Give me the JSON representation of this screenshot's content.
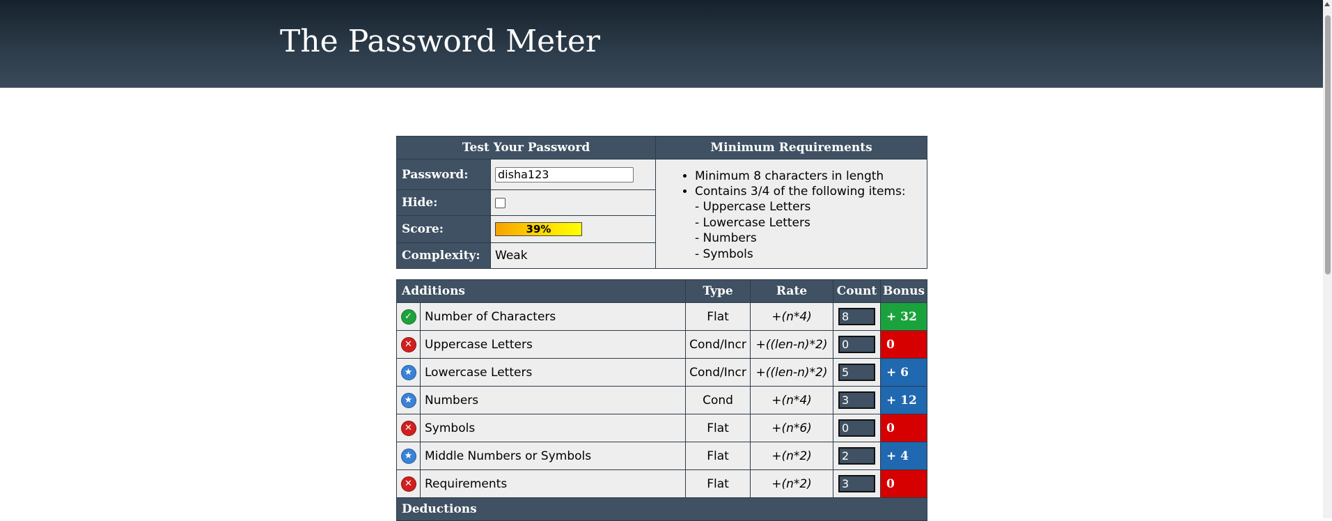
{
  "header": {
    "title": "The Password Meter"
  },
  "test": {
    "title": "Test Your Password",
    "password_label": "Password:",
    "password_value": "disha123",
    "hide_label": "Hide:",
    "score_label": "Score:",
    "score_text": "39%",
    "score_percent": 39,
    "complexity_label": "Complexity:",
    "complexity_value": "Weak"
  },
  "requirements": {
    "title": "Minimum Requirements",
    "bullets": [
      "Minimum 8 characters in length",
      "Contains 3/4 of the following items:"
    ],
    "sub_items": [
      "- Uppercase Letters",
      "- Lowercase Letters",
      "- Numbers",
      "- Symbols"
    ]
  },
  "additions": {
    "headers": {
      "name": "Additions",
      "type": "Type",
      "rate": "Rate",
      "count": "Count",
      "bonus": "Bonus"
    },
    "rows": [
      {
        "status": "ok",
        "icon": "check-icon",
        "name": "Number of Characters",
        "type": "Flat",
        "rate": "+(n*4)",
        "count": "8",
        "bonus": "+ 32",
        "bonus_color": "#1aa33c"
      },
      {
        "status": "fail",
        "icon": "x-icon",
        "name": "Uppercase Letters",
        "type": "Cond/Incr",
        "rate": "+((len-n)*2)",
        "count": "0",
        "bonus": "0",
        "bonus_color": "#d60000"
      },
      {
        "status": "exceed",
        "icon": "star-icon",
        "name": "Lowercase Letters",
        "type": "Cond/Incr",
        "rate": "+((len-n)*2)",
        "count": "5",
        "bonus": "+ 6",
        "bonus_color": "#2068b0"
      },
      {
        "status": "exceed",
        "icon": "star-icon",
        "name": "Numbers",
        "type": "Cond",
        "rate": "+(n*4)",
        "count": "3",
        "bonus": "+ 12",
        "bonus_color": "#2068b0"
      },
      {
        "status": "fail",
        "icon": "x-icon",
        "name": "Symbols",
        "type": "Flat",
        "rate": "+(n*6)",
        "count": "0",
        "bonus": "0",
        "bonus_color": "#d60000"
      },
      {
        "status": "exceed",
        "icon": "star-icon",
        "name": "Middle Numbers or Symbols",
        "type": "Flat",
        "rate": "+(n*2)",
        "count": "2",
        "bonus": "+ 4",
        "bonus_color": "#2068b0"
      },
      {
        "status": "fail",
        "icon": "x-icon",
        "name": "Requirements",
        "type": "Flat",
        "rate": "+(n*2)",
        "count": "3",
        "bonus": "0",
        "bonus_color": "#d60000"
      }
    ]
  },
  "deductions": {
    "title": "Deductions"
  }
}
